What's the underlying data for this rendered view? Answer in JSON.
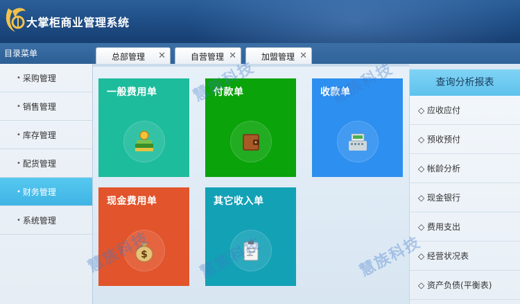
{
  "app": {
    "title": "大掌柜商业管理系统",
    "logo_icon": "company-logo-icon"
  },
  "sidebar": {
    "header": "目录菜单",
    "items": [
      {
        "label": "采购管理",
        "active": false
      },
      {
        "label": "销售管理",
        "active": false
      },
      {
        "label": "库存管理",
        "active": false
      },
      {
        "label": "配货管理",
        "active": false
      },
      {
        "label": "财务管理",
        "active": true
      },
      {
        "label": "系统管理",
        "active": false
      }
    ]
  },
  "tabs": [
    {
      "label": "总部管理",
      "active": true
    },
    {
      "label": "自营管理",
      "active": false
    },
    {
      "label": "加盟管理",
      "active": false
    }
  ],
  "tiles": [
    {
      "label": "一般费用单",
      "color": "#1dbc9c",
      "icon": "books-coins-icon"
    },
    {
      "label": "付款单",
      "color": "#0aa30a",
      "icon": "wallet-icon"
    },
    {
      "label": "收款单",
      "color": "#2d8ff0",
      "icon": "cash-register-icon"
    },
    {
      "label": "现金费用单",
      "color": "#e2542b",
      "icon": "money-bag-icon"
    },
    {
      "label": "其它收入单",
      "color": "#13a1b6",
      "icon": "clipboard-icon"
    }
  ],
  "watermark": "慧族科技",
  "report_panel": {
    "title": "查询分析报表",
    "items": [
      "◇ 应收应付",
      "◇ 预收预付",
      "◇ 帐龄分析",
      "◇ 现金银行",
      "◇ 费用支出",
      "◇ 经营状况表",
      "◇ 资产负债(平衡表)"
    ]
  }
}
